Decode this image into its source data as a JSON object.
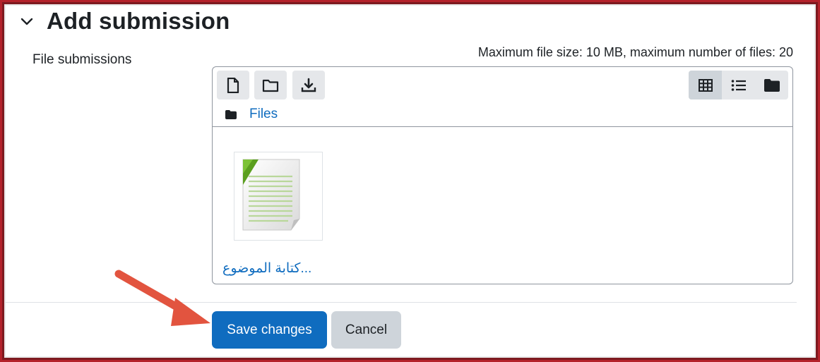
{
  "section": {
    "title": "Add submission",
    "expanded": true
  },
  "field": {
    "label": "File submissions",
    "limits_text": "Maximum file size: 10 MB, maximum number of files: 20"
  },
  "file_manager": {
    "toolbar": {
      "left_buttons": [
        "new-file-icon",
        "new-folder-icon",
        "download-icon"
      ],
      "view_buttons": [
        "grid-view-icon",
        "list-view-icon",
        "tree-view-icon"
      ],
      "active_view": "grid-view-icon"
    },
    "path_label": "Files",
    "files": [
      {
        "name": "...كتابة الموضوع",
        "icon": "document-icon"
      }
    ]
  },
  "actions": {
    "save_label": "Save changes",
    "cancel_label": "Cancel"
  },
  "colors": {
    "primary": "#0f6cbf",
    "secondary": "#ced4da",
    "annotation_arrow": "#e2543f",
    "frame": "#b4222b"
  }
}
